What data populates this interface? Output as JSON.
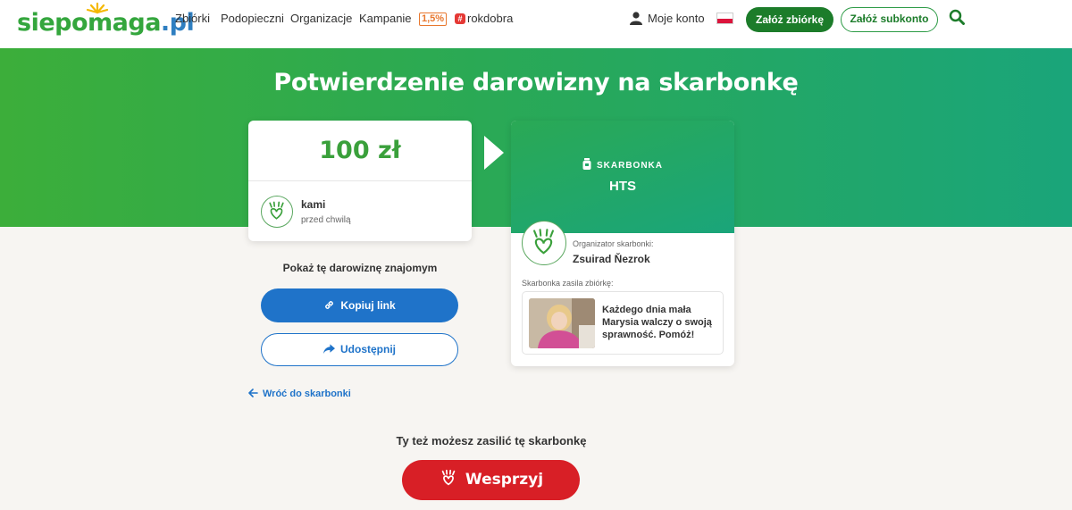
{
  "header": {
    "logo": {
      "main": "siepomaga",
      "suffix": ".pl"
    },
    "nav": [
      {
        "label": "Zbiórki"
      },
      {
        "label": "Podopieczni"
      },
      {
        "label": "Organizacje"
      },
      {
        "label": "Kampanie"
      }
    ],
    "badge_15": "1,5%",
    "rokdobra": "rokdobra",
    "account_label": "Moje konto",
    "language_flag": "pl-flag",
    "create_fundraiser_label": "Załóż zbiórkę",
    "create_subaccount_label": "Załóż subkonto",
    "search_icon": "search-icon",
    "colors": {
      "brand_green": "#1c7c2a",
      "brand_blue": "#2f7fc1"
    }
  },
  "hero": {
    "title": "Potwierdzenie darowizny na skarbonkę",
    "gradient": [
      "#3cae3a",
      "#1aa57a"
    ]
  },
  "donation": {
    "amount": "100 zł",
    "donor_name": "kami",
    "time": "przed chwilą"
  },
  "share": {
    "heading": "Pokaż tę darowiznę znajomym",
    "copy_label": "Kopiuj link",
    "share_label": "Udostępnij",
    "back_label": "Wróć do skarbonki"
  },
  "skarbonka": {
    "label": "SKARBONKA",
    "name": "HTS",
    "organizer_label": "Organizator skarbonki:",
    "organizer_name": "Zsuirad Ňezrok",
    "feeds_label": "Skarbonka zasila zbiórkę:",
    "campaign_title": "Każdego dnia mała Marysia walczy o swoją sprawność. Pomóż!"
  },
  "support": {
    "heading": "Ty też możesz zasilić tę skarbonkę",
    "button_label": "Wesprzyj",
    "color": "#d81f26"
  }
}
